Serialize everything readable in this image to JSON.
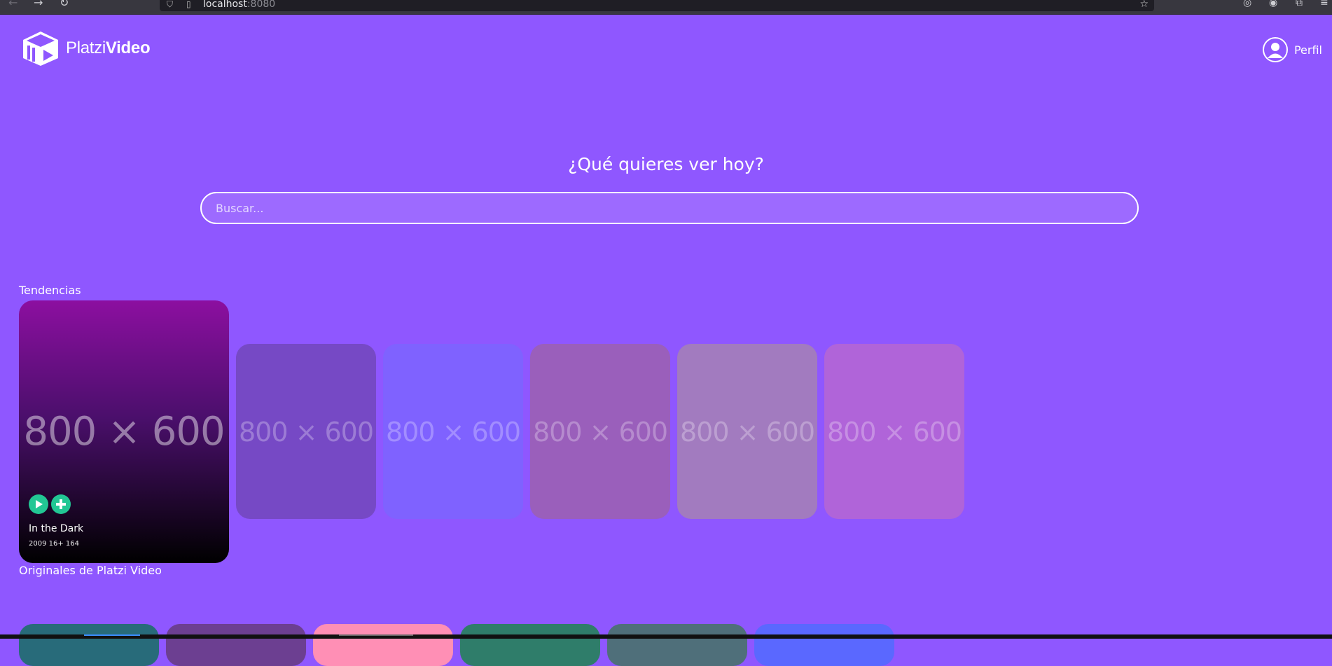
{
  "browser": {
    "url_host": "localhost",
    "url_port": ":8080"
  },
  "header": {
    "logo_light": "Platzi",
    "logo_bold": "Video",
    "profile_label": "Perfil"
  },
  "search": {
    "title": "¿Qué quieres ver hoy?",
    "placeholder": "Buscar..."
  },
  "trends": {
    "title": "Tendencias",
    "featured": {
      "placeholder": "800 × 600",
      "title": "In the Dark",
      "meta": "2009 16+ 164"
    },
    "cards": [
      {
        "placeholder": "800 × 600",
        "color": "#7649c5"
      },
      {
        "placeholder": "800 × 600",
        "color": "#7f62ff"
      },
      {
        "placeholder": "800 × 600",
        "color": "#9a5fbb"
      },
      {
        "placeholder": "800 × 600",
        "color": "#a27bbf"
      },
      {
        "placeholder": "800 × 600",
        "color": "#b064d9"
      }
    ]
  },
  "originals": {
    "title": "Originales de Platzi Video",
    "cards": [
      {
        "color": "#286b7a"
      },
      {
        "color": "#6c3f91"
      },
      {
        "color": "#ff8fb5"
      },
      {
        "color": "#2f7d6a"
      },
      {
        "color": "#4f6f7a"
      },
      {
        "color": "#5a68ff"
      }
    ]
  },
  "colors": {
    "background": "#8f57ff",
    "accent": "#22c794"
  }
}
